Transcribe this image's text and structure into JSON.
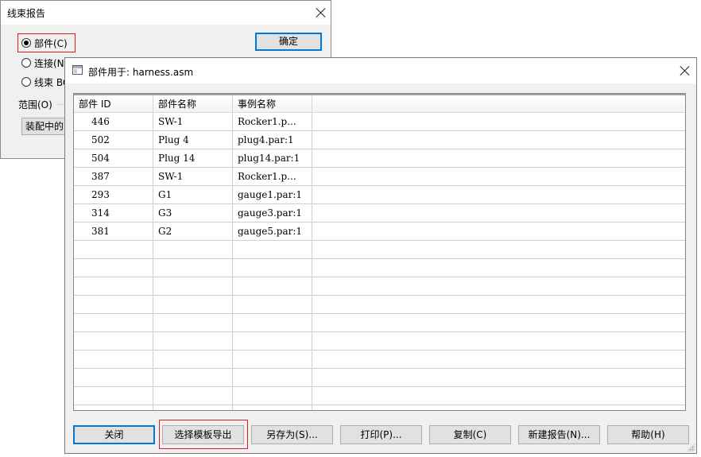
{
  "report_dialog": {
    "title": "线束报告",
    "options": [
      "部件(C)",
      "连接(N",
      "线束 BC"
    ],
    "selected_index": 0,
    "ok_label": "确定",
    "scope_label": "范围(O)",
    "scope_button": "装配中的"
  },
  "parts_window": {
    "title": "部件用于: harness.asm",
    "columns": [
      "部件 ID",
      "部件名称",
      "事例名称"
    ],
    "rows": [
      [
        "446",
        "SW-1",
        "Rocker1.p..."
      ],
      [
        "502",
        "Plug 4",
        "plug4.par:1"
      ],
      [
        "504",
        "Plug 14",
        "plug14.par:1"
      ],
      [
        "387",
        "SW-1",
        "Rocker1.p..."
      ],
      [
        "293",
        "G1",
        "gauge1.par:1"
      ],
      [
        "314",
        "G3",
        "gauge3.par:1"
      ],
      [
        "381",
        "G2",
        "gauge5.par:1"
      ]
    ],
    "buttons": {
      "close": "关闭",
      "export_template": "选择模板导出",
      "save_as": "另存为(S)...",
      "print": "打印(P)...",
      "copy": "复制(C)",
      "new_report": "新建报告(N)...",
      "help": "帮助(H)"
    }
  },
  "colors": {
    "highlight_red": "#d61f26",
    "focus_blue": "#0078d7"
  }
}
